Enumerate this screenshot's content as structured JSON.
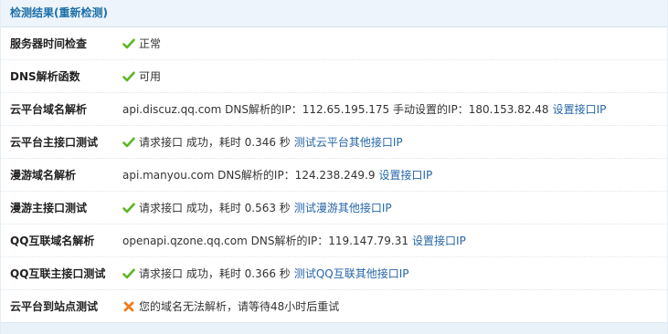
{
  "header": {
    "title": "检测结果(",
    "recheck_link": "重新检测",
    "title_end": ")"
  },
  "rows": [
    {
      "label": "服务器时间检查",
      "status_icon": "check-icon",
      "text": "正常"
    },
    {
      "label": "DNS解析函数",
      "status_icon": "check-icon",
      "text": "可用"
    },
    {
      "label": "云平台域名解析",
      "text": "api.discuz.qq.com DNS解析的IP：112.65.195.175 手动设置的IP：180.153.82.48",
      "link": "设置接口IP"
    },
    {
      "label": "云平台主接口测试",
      "status_icon": "check-icon",
      "text": "请求接口 成功，耗时 0.346 秒",
      "link": "测试云平台其他接口IP"
    },
    {
      "label": "漫游域名解析",
      "text": "api.manyou.com DNS解析的IP：124.238.249.9",
      "link": "设置接口IP"
    },
    {
      "label": "漫游主接口测试",
      "status_icon": "check-icon",
      "text": "请求接口 成功，耗时 0.563 秒",
      "link": "测试漫游其他接口IP"
    },
    {
      "label": "QQ互联域名解析",
      "text": "openapi.qzone.qq.com DNS解析的IP：119.147.79.31",
      "link": "设置接口IP"
    },
    {
      "label": "QQ互联主接口测试",
      "status_icon": "check-icon",
      "text": "请求接口 成功，耗时 0.366 秒",
      "link": "测试QQ互联其他接口IP"
    },
    {
      "label": "云平台到站点测试",
      "status_icon": "cross-icon",
      "text": "您的域名无法解析，请等待48小时后重试"
    }
  ],
  "colors": {
    "header_bg": "#edf4fb",
    "header_text": "#1c6fa8",
    "link": "#2766a8",
    "check": "#5fb425",
    "cross": "#f07d1b"
  }
}
